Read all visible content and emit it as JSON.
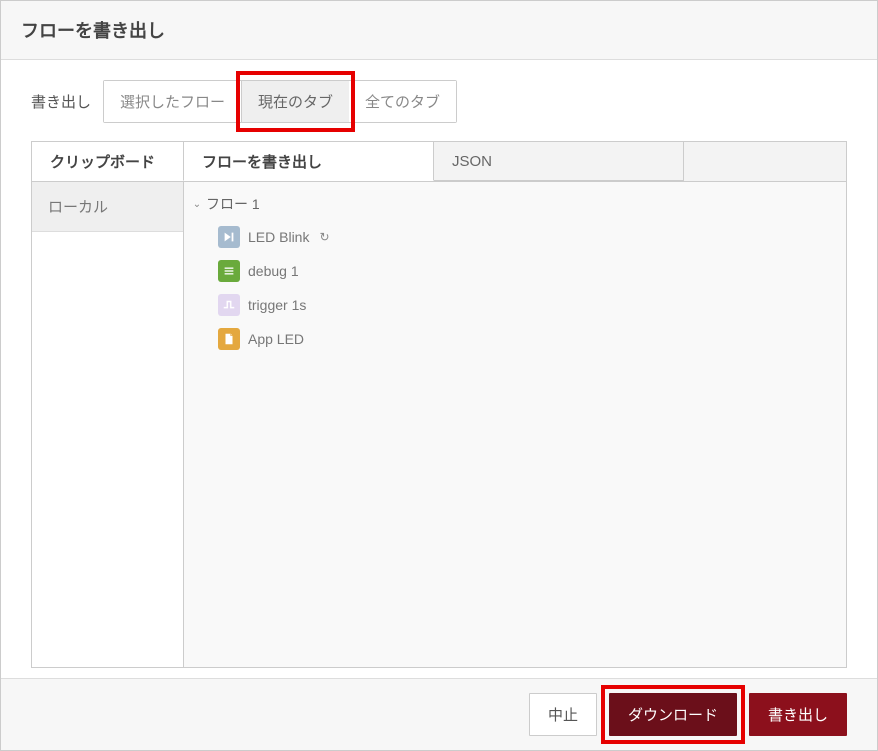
{
  "header": {
    "title": "フローを書き出し"
  },
  "exportRow": {
    "label": "書き出し",
    "options": {
      "selected": "選択したフロー",
      "current": "現在のタブ",
      "all": "全てのタブ"
    }
  },
  "tabs": {
    "clipboard": "クリップボード",
    "exportFlow": "フローを書き出し",
    "json": "JSON"
  },
  "sidebar": {
    "local": "ローカル"
  },
  "flow": {
    "groupName": "フロー 1",
    "nodes": [
      {
        "label": "LED Blink",
        "suffix": "↻",
        "iconBg": "#a6bbcf",
        "type": "inject"
      },
      {
        "label": "debug 1",
        "suffix": "",
        "iconBg": "#6aaa3c",
        "type": "debug"
      },
      {
        "label": "trigger 1s",
        "suffix": "",
        "iconBg": "#e2d7f0",
        "type": "trigger"
      },
      {
        "label": "App LED",
        "suffix": "",
        "iconBg": "#e4a83f",
        "type": "function"
      }
    ]
  },
  "footer": {
    "cancel": "中止",
    "download": "ダウンロード",
    "export": "書き出し"
  }
}
